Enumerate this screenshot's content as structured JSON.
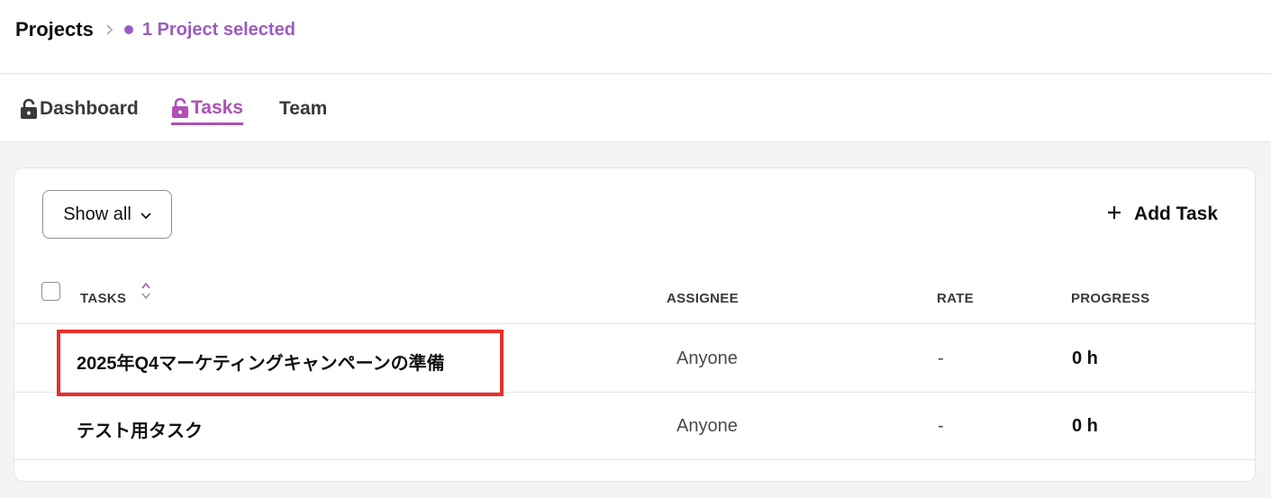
{
  "breadcrumb": {
    "root": "Projects",
    "current": "1 Project selected"
  },
  "tabs": [
    {
      "label": "Dashboard",
      "icon": "lock-icon",
      "active": false
    },
    {
      "label": "Tasks",
      "icon": "lock-icon",
      "active": true
    },
    {
      "label": "Team",
      "active": false
    }
  ],
  "toolbar": {
    "filter_label": "Show all",
    "add_task_label": "Add Task"
  },
  "table": {
    "columns": [
      "TASKS",
      "ASSIGNEE",
      "RATE",
      "PROGRESS"
    ],
    "rows": [
      {
        "task": "2025年Q4マーケティングキャンペーンの準備",
        "assignee": "Anyone",
        "rate": "-",
        "progress": "0 h",
        "highlighted": true
      },
      {
        "task": "テスト用タスク",
        "assignee": "Anyone",
        "rate": "-",
        "progress": "0 h",
        "highlighted": false
      }
    ]
  },
  "colors": {
    "accent": "#b04fb6",
    "breadcrumb_accent": "#9b5cc0",
    "highlight": "#e8302a",
    "text_dark": "#111111",
    "text_muted": "#4a4a4a",
    "divider": "#e6e5ea",
    "page_bg": "#f4f3f6"
  }
}
